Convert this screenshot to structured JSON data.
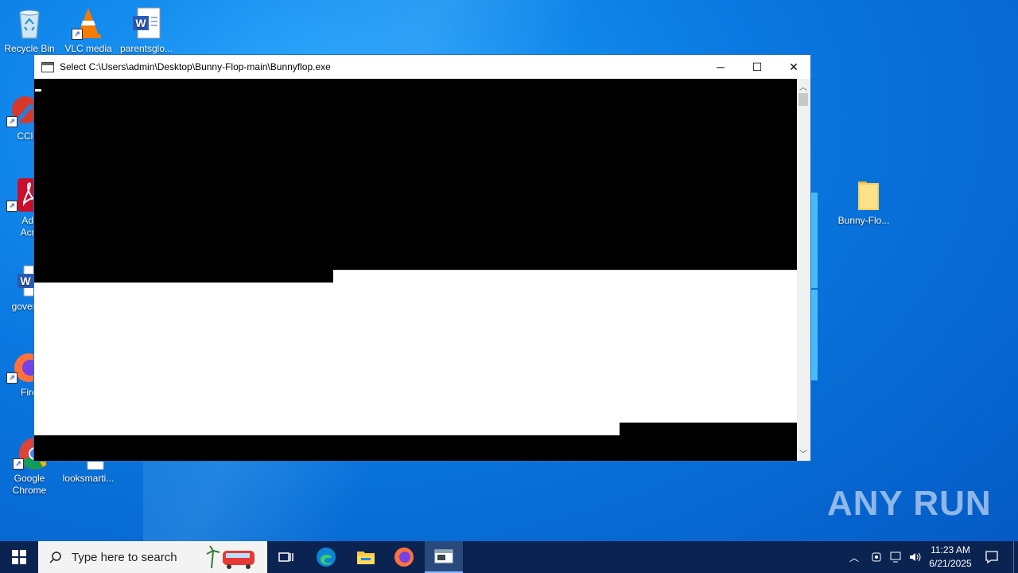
{
  "desktop": {
    "icons": [
      {
        "label": "Recycle Bin"
      },
      {
        "label": "VLC media"
      },
      {
        "label": "parentsglo..."
      },
      {
        "label": "CClea"
      },
      {
        "label": "Ado\nAcro"
      },
      {
        "label": "govern"
      },
      {
        "label": "Firef"
      },
      {
        "label": "Google\nChrome"
      },
      {
        "label": "looksmarti..."
      },
      {
        "label": "Bunny-Flo..."
      }
    ]
  },
  "window": {
    "title": "Select C:\\Users\\admin\\Desktop\\Bunny-Flop-main\\Bunnyflop.exe",
    "minimize": "─",
    "maximize": "☐",
    "close": "✕"
  },
  "taskbar": {
    "search_placeholder": "Type here to search",
    "time": "11:23 AM",
    "date": "6/21/2025"
  },
  "watermark": "ANY RUN",
  "colors": {
    "desktop": "#0a78e0",
    "taskbar": "#0b2350",
    "console_bg": "#000000"
  }
}
